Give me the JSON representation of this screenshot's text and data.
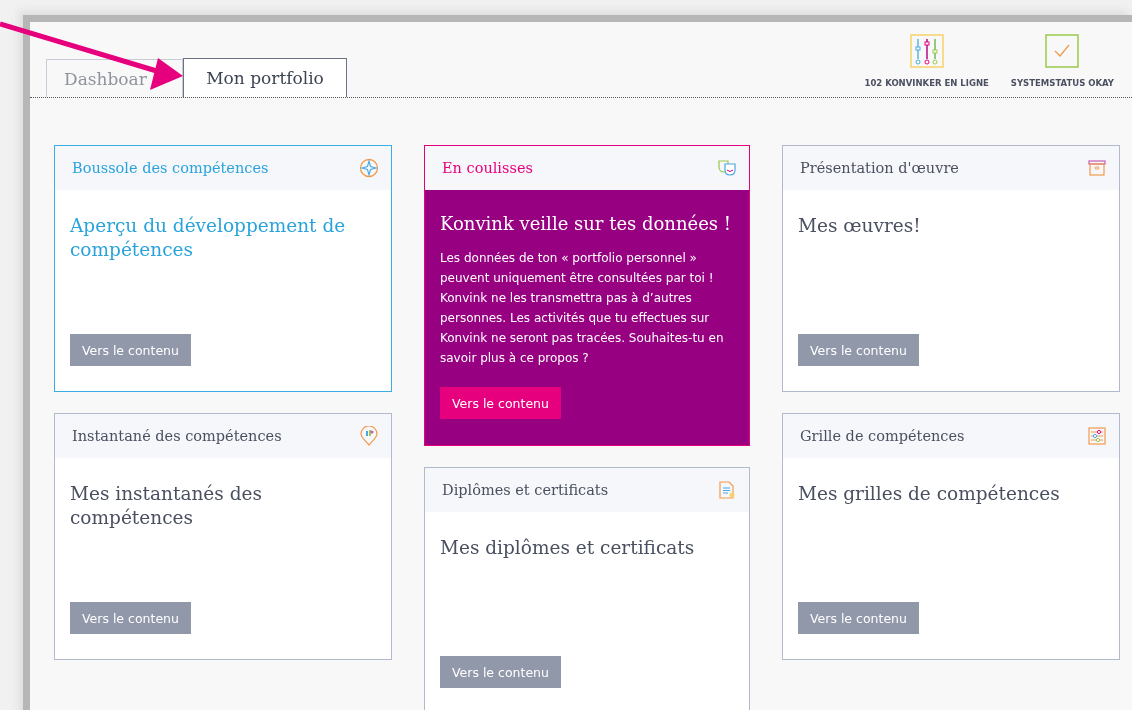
{
  "tabs": [
    {
      "label": "Dashboar",
      "selected": false
    },
    {
      "label": "Mon portfolio",
      "selected": true
    }
  ],
  "status": [
    {
      "label": "102 KONVINKER EN LIGNE"
    },
    {
      "label": "SYSTEMSTATUS OKAY"
    }
  ],
  "columns": [
    {
      "cards": [
        {
          "kind": "accent",
          "title": "Boussole des compétences",
          "heading": "Aperçu du développement de compétences",
          "button": "Vers le contenu"
        },
        {
          "kind": "plain",
          "title": "Instantané des compétences",
          "heading": "Mes instantanés des compétences",
          "button": "Vers le contenu"
        }
      ]
    },
    {
      "cards": [
        {
          "kind": "featured",
          "title": "En coulisses",
          "heading": "Konvink veille sur tes données !",
          "text": "Les données de ton « portfolio personnel » peuvent uniquement être consultées par toi ! Konvink ne les transmettra pas à d’autres personnes. Les activités que tu effectues sur Konvink ne seront pas tracées. Souhaites-tu en savoir plus à ce propos ?",
          "button": "Vers le contenu"
        },
        {
          "kind": "plain",
          "title": "Diplômes et certificats",
          "heading": "Mes diplômes et certificats",
          "button": "Vers le contenu"
        }
      ]
    },
    {
      "cards": [
        {
          "kind": "plain",
          "title": "Présentation d'œuvre",
          "heading": "Mes œuvres!",
          "button": "Vers le contenu"
        },
        {
          "kind": "plain",
          "title": "Grille de compétences",
          "heading": "Mes grilles de compétences",
          "button": "Vers le contenu"
        }
      ]
    }
  ]
}
